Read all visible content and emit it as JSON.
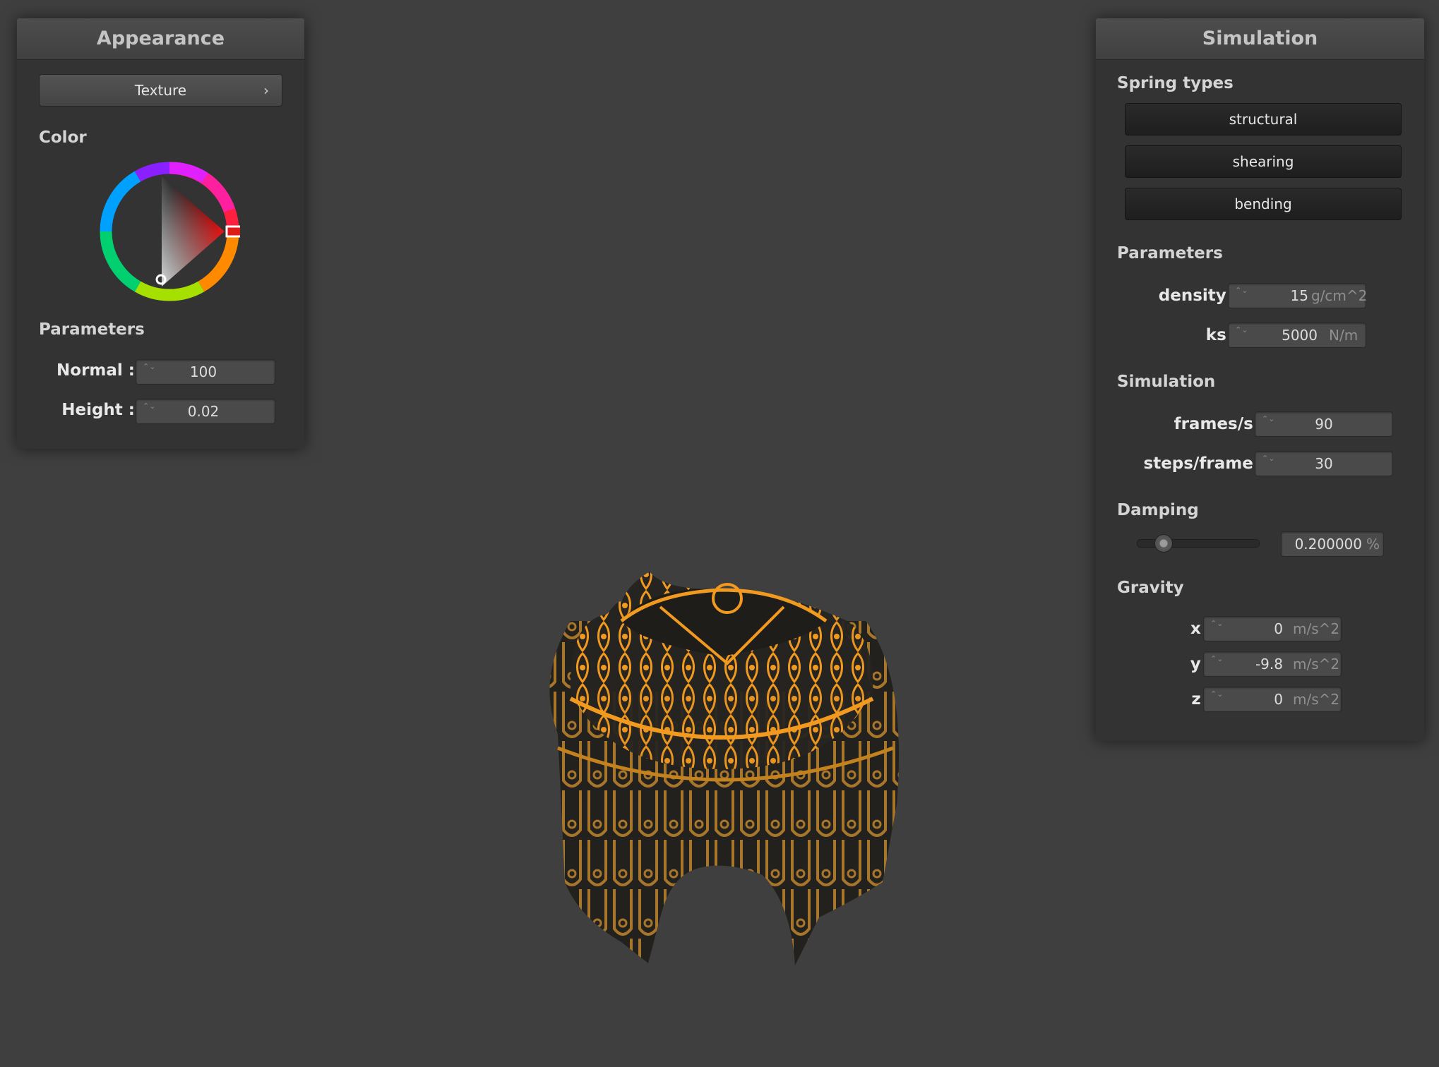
{
  "appearance": {
    "title": "Appearance",
    "texture_button": "Texture",
    "chevron_glyph": "›",
    "color_section": "Color",
    "selected_color": "#e01919",
    "parameters_section": "Parameters",
    "normal_label": "Normal :",
    "normal_value": "100",
    "height_label": "Height :",
    "height_value": "0.02"
  },
  "simulation": {
    "title": "Simulation",
    "spring_types_section": "Spring types",
    "spring_buttons": [
      "structural",
      "shearing",
      "bending"
    ],
    "parameters_section": "Parameters",
    "density_label": "density :",
    "density_value": "15",
    "density_unit": "g/cm^2",
    "ks_label": "ks :",
    "ks_value": "5000",
    "ks_unit": "N/m",
    "simulation_section": "Simulation",
    "fps_label": "frames/s :",
    "fps_value": "90",
    "steps_label": "steps/frame :",
    "steps_value": "30",
    "damping_section": "Damping",
    "damping_value": "0.200000",
    "damping_unit": "%",
    "damping_fraction": 0.2,
    "gravity_section": "Gravity",
    "gx_label": "x :",
    "gx_value": "0",
    "gy_label": "y :",
    "gy_value": "-9.8",
    "gz_label": "z :",
    "gz_value": "0",
    "gravity_unit": "m/s^2"
  },
  "colors": {
    "background": "#3f3f3f",
    "cloth_orange": "#f2991e",
    "cloth_dark": "#262420"
  },
  "spinner_glyphs": "⌃⌄"
}
